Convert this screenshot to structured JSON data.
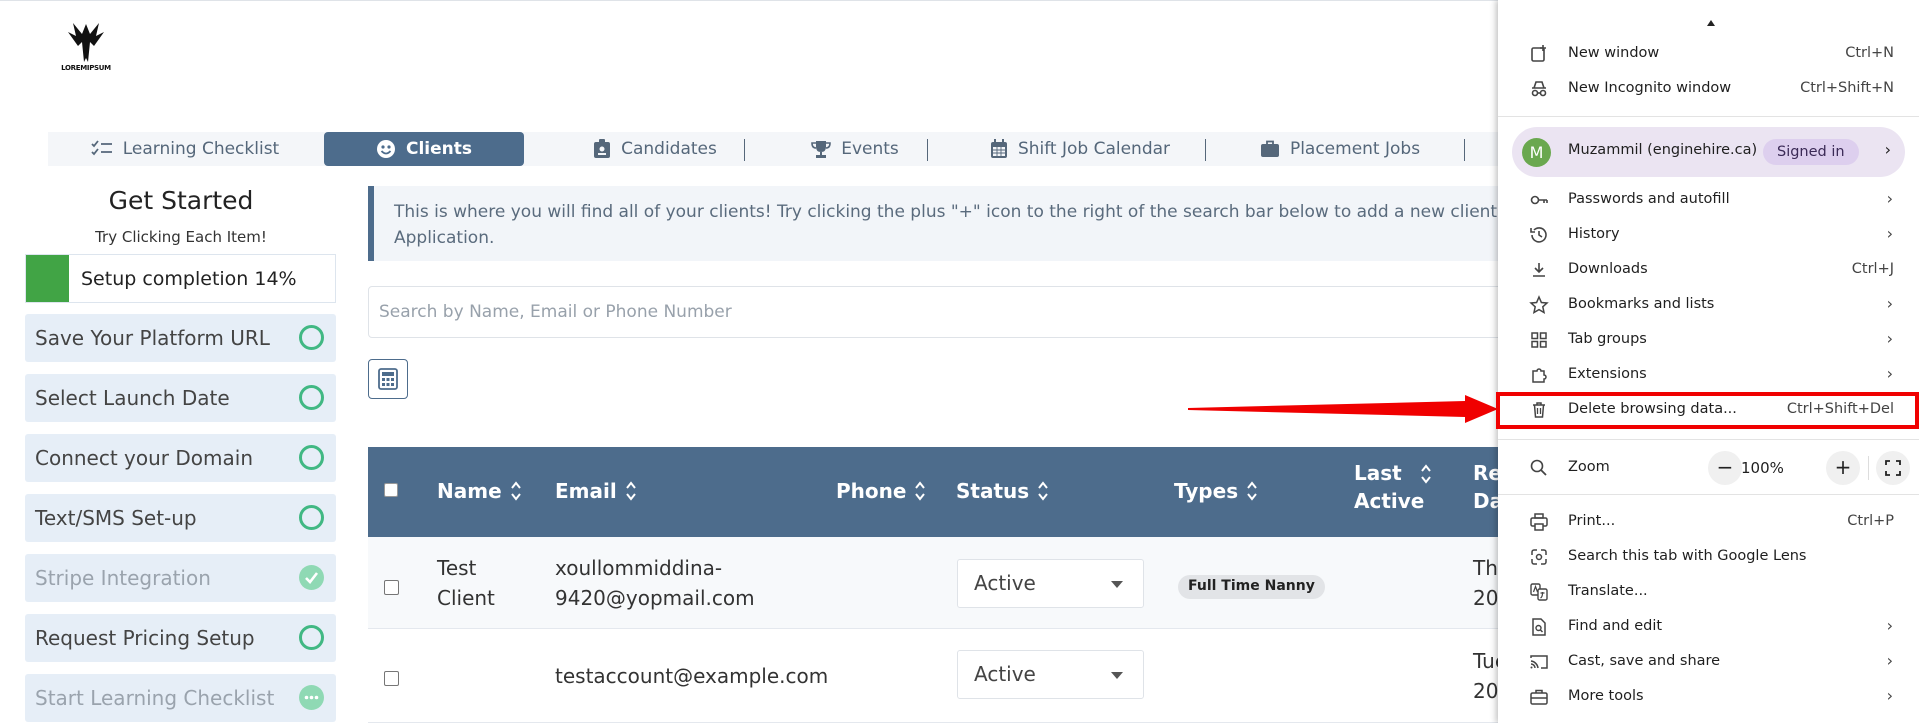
{
  "brand": {
    "logo_text": "LOREMIPSUM"
  },
  "nav": {
    "tabs": [
      {
        "label": "Learning Checklist",
        "icon": "checklist-icon"
      },
      {
        "label": "Clients",
        "icon": "smile-icon"
      },
      {
        "label": "Candidates",
        "icon": "id-badge-icon"
      },
      {
        "label": "Events",
        "icon": "trophy-icon"
      },
      {
        "label": "Shift Job Calendar",
        "icon": "calendar-icon"
      },
      {
        "label": "Placement Jobs",
        "icon": "briefcase-icon"
      }
    ]
  },
  "sidebar": {
    "title": "Get Started",
    "subtitle": "Try Clicking Each Item!",
    "progress_label": "Setup completion 14%",
    "progress_value": 0.14,
    "items": [
      {
        "label": "Save Your Platform URL",
        "state": "open"
      },
      {
        "label": "Select Launch Date",
        "state": "open"
      },
      {
        "label": "Connect your Domain",
        "state": "open"
      },
      {
        "label": "Text/SMS Set-up",
        "state": "open"
      },
      {
        "label": "Stripe Integration",
        "state": "done"
      },
      {
        "label": "Request Pricing Setup",
        "state": "open"
      },
      {
        "label": "Start Learning Checklist",
        "state": "in-progress"
      }
    ]
  },
  "main": {
    "info_line1": "This is where you will find all of your clients! Try clicking the plus \"+\" icon to the right of the search bar below to add a new client, or the ico",
    "info_line2": "Application.",
    "search_placeholder": "Search by Name, Email or Phone Number",
    "table": {
      "headers": {
        "name": "Name",
        "email": "Email",
        "phone": "Phone",
        "status": "Status",
        "types": "Types",
        "last_active_1": "Last",
        "last_active_2": "Active",
        "reg_1": "Re",
        "reg_2": "Da"
      },
      "rows": [
        {
          "name_1": "Test",
          "name_2": "Client",
          "email_1": "xoullommiddina-",
          "email_2": "9420@yopmail.com",
          "status": "Active",
          "type": "Full Time Nanny",
          "reg_1": "Th",
          "reg_2": "20"
        },
        {
          "name_1": "",
          "name_2": "",
          "email_1": "testaccount@example.com",
          "email_2": "",
          "status": "Active",
          "type": "",
          "reg_1": "Tue",
          "reg_2": "20"
        }
      ]
    }
  },
  "browser_menu": {
    "items": {
      "new_window": {
        "label": "New window",
        "shortcut": "Ctrl+N"
      },
      "incognito": {
        "label": "New Incognito window",
        "shortcut": "Ctrl+Shift+N"
      },
      "passwords": {
        "label": "Passwords and autofill"
      },
      "history": {
        "label": "History"
      },
      "downloads": {
        "label": "Downloads",
        "shortcut": "Ctrl+J"
      },
      "bookmarks": {
        "label": "Bookmarks and lists"
      },
      "tab_groups": {
        "label": "Tab groups"
      },
      "extensions": {
        "label": "Extensions"
      },
      "delete_data": {
        "label": "Delete browsing data...",
        "shortcut": "Ctrl+Shift+Del"
      },
      "print": {
        "label": "Print...",
        "shortcut": "Ctrl+P"
      },
      "lens": {
        "label": "Search this tab with Google Lens"
      },
      "translate": {
        "label": "Translate..."
      },
      "find_edit": {
        "label": "Find and edit"
      },
      "cast": {
        "label": "Cast, save and share"
      },
      "more_tools": {
        "label": "More tools"
      }
    },
    "profile": {
      "initial": "M",
      "name": "Muzammil (enginehire.ca)",
      "status": "Signed in"
    },
    "zoom": {
      "label": "Zoom",
      "value": "100%",
      "minus": "−",
      "plus": "+"
    }
  },
  "colors": {
    "accent": "#4d6c8c",
    "progress": "#41a445",
    "check": "#41b883",
    "highlight": "#f00000"
  }
}
